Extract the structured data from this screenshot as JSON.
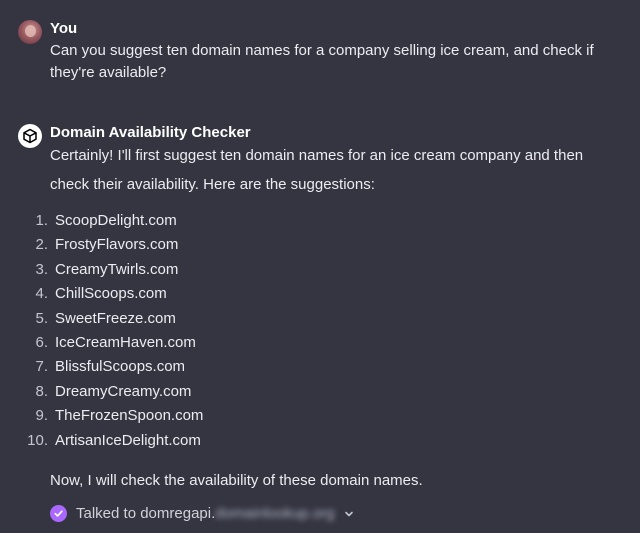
{
  "user_message": {
    "author": "You",
    "text": "Can you suggest ten domain names for a company selling ice cream, and check if they're available?"
  },
  "assistant_message": {
    "author": "Domain Availability Checker",
    "intro": "Certainly! I'll first suggest ten domain names for an ice cream company and then check their availability. Here are the suggestions:",
    "domains": [
      {
        "number": "1",
        "name": "ScoopDelight.com"
      },
      {
        "number": "2",
        "name": "FrostyFlavors.com"
      },
      {
        "number": "3",
        "name": "CreamyTwirls.com"
      },
      {
        "number": "4",
        "name": "ChillScoops.com"
      },
      {
        "number": "5",
        "name": "SweetFreeze.com"
      },
      {
        "number": "6",
        "name": "IceCreamHaven.com"
      },
      {
        "number": "7",
        "name": "BlissfulScoops.com"
      },
      {
        "number": "8",
        "name": "DreamyCreamy.com"
      },
      {
        "number": "9",
        "name": "TheFrozenSpoon.com"
      },
      {
        "number": "10",
        "name": "ArtisanIceDelight.com"
      }
    ],
    "followup": "Now, I will check the availability of these domain names.",
    "tool_call": {
      "label": "Talked to domregapi.",
      "blurred_suffix": "domainlookup.org",
      "status_icon": "check-circle-icon",
      "expand_icon": "chevron-down-icon"
    }
  },
  "colors": {
    "background": "#343541",
    "text": "#ececf1",
    "accent_check": "#ab68ff"
  }
}
